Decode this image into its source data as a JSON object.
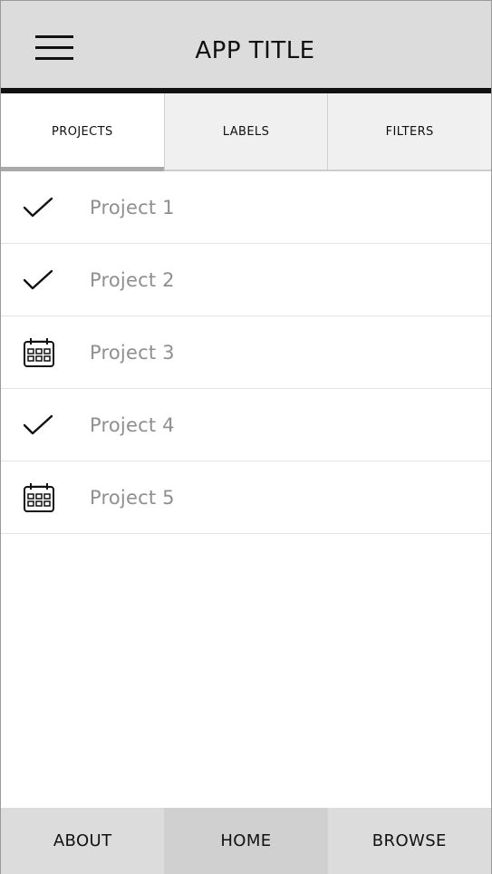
{
  "header": {
    "title": "APP TITLE",
    "menu_icon": "hamburger-menu-icon"
  },
  "tabs": [
    {
      "label": "PROJECTS",
      "active": true
    },
    {
      "label": "LABELS",
      "active": false
    },
    {
      "label": "FILTERS",
      "active": false
    }
  ],
  "projects": [
    {
      "label": "Project 1",
      "icon": "checkmark-icon"
    },
    {
      "label": "Project 2",
      "icon": "checkmark-icon"
    },
    {
      "label": "Project 3",
      "icon": "calendar-icon"
    },
    {
      "label": "Project 4",
      "icon": "checkmark-icon"
    },
    {
      "label": "Project 5",
      "icon": "calendar-icon"
    }
  ],
  "bottom_nav": [
    {
      "label": "ABOUT",
      "active": false
    },
    {
      "label": "HOME",
      "active": true
    },
    {
      "label": "BROWSE",
      "active": false
    }
  ],
  "colors": {
    "header_bg": "#dcdcdc",
    "header_rule": "#111111",
    "tab_inactive_bg": "#f0f0f0",
    "tab_indicator": "#a9a9a9",
    "item_text": "#8f8f8f",
    "bottom_nav_bg": "#dcdcdc",
    "bottom_nav_active_bg": "#d0d0d0"
  }
}
